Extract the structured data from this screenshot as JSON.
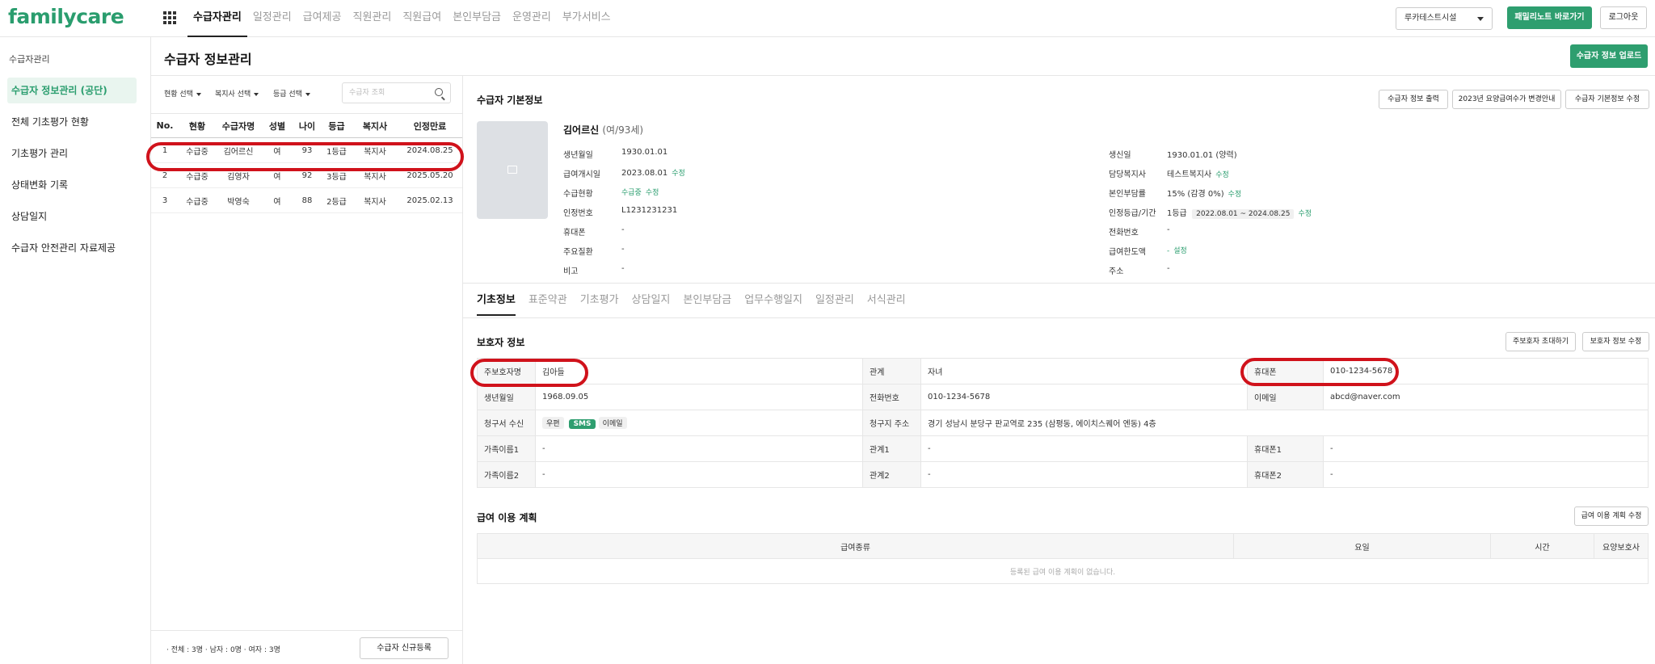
{
  "app": {
    "logo": "familycare"
  },
  "nav": {
    "items": [
      "수급자관리",
      "일정관리",
      "급여제공",
      "직원관리",
      "직원급여",
      "본인부담금",
      "운영관리",
      "부가서비스"
    ],
    "active_index": 0
  },
  "header": {
    "facility_select": "루카테스트시설",
    "family_button": "패밀리노트 바로가기",
    "logout_button": "로그아웃"
  },
  "sidebar": {
    "heading": "수급자관리",
    "items": [
      "수급자 정보관리 (공단)",
      "전체 기초평가 현황",
      "기초평가 관리",
      "상태변화 기록",
      "상담일지",
      "수급자 안전관리 자료제공"
    ],
    "active_index": 0
  },
  "page": {
    "title": "수급자 정보관리",
    "upload_button": "수급자 정보 업로드"
  },
  "list": {
    "filters": [
      "현황 선택",
      "복지사 선택",
      "등급 선택"
    ],
    "search_placeholder": "수급자 조회",
    "columns": [
      "No.",
      "현황",
      "수급자명",
      "성별",
      "나이",
      "등급",
      "복지사",
      "인정만료"
    ],
    "rows": [
      [
        "1",
        "수급중",
        "김어르신",
        "여",
        "93",
        "1등급",
        "복지사",
        "2024.08.25"
      ],
      [
        "2",
        "수급중",
        "김영자",
        "여",
        "92",
        "3등급",
        "복지사",
        "2025.05.20"
      ],
      [
        "3",
        "수급중",
        "박영숙",
        "여",
        "88",
        "2등급",
        "복지사",
        "2025.02.13"
      ]
    ],
    "counts": "· 전체 : 3명    · 남자 : 0명    · 여자 : 3명",
    "new_button": "수급자 신규등록"
  },
  "basic": {
    "title": "수급자 기본정보",
    "buttons": [
      "수급자 정보 출력",
      "2023년 요양급여수가 변경안내",
      "수급자 기본정보 수정"
    ],
    "name": "김어르신",
    "age": "(여/93세)",
    "left": {
      "labels": [
        "생년월일",
        "급여개시일",
        "수급현황",
        "인정번호",
        "휴대폰",
        "주요질환",
        "비고"
      ],
      "birth": "1930.01.01",
      "start": "2023.08.01",
      "status": "수급중",
      "cert_no": "L1231231231",
      "phone": "-",
      "disease": "-",
      "note": "-"
    },
    "right": {
      "labels": [
        "생신일",
        "담당복지사",
        "본인부담률",
        "인정등급/기간",
        "전화번호",
        "급여한도액",
        "주소"
      ],
      "birthday": "1930.01.01 (양력)",
      "worker": "테스트복지사",
      "rate": "15% (감경 0%)",
      "grade": "1등급",
      "period": "2022.08.01 ~ 2024.08.25",
      "tel": "-",
      "limit": "-",
      "limit_link": "설정",
      "address": "-"
    },
    "edit_label": "수정"
  },
  "tabs": [
    "기초정보",
    "표준약관",
    "기초평가",
    "상담일지",
    "본인부담금",
    "업무수행일지",
    "일정관리",
    "서식관리"
  ],
  "guardian": {
    "title": "보호자 정보",
    "buttons": [
      "주보호자 초대하기",
      "보호자 정보 수정"
    ],
    "rows": [
      [
        "주보호자명",
        "김아들",
        "관계",
        "자녀",
        "휴대폰",
        "010-1234-5678"
      ],
      [
        "생년월일",
        "1968.09.05",
        "전화번호",
        "010-1234-5678",
        "이메일",
        "abcd@naver.com"
      ],
      [
        "청구서 수신",
        "",
        "청구지 주소",
        "경기 성남시 분당구 판교역로 235 (삼평동, 에이치스퀘어 엔동) 4층",
        "",
        ""
      ],
      [
        "가족이름1",
        "-",
        "관계1",
        "-",
        "휴대폰1",
        "-"
      ],
      [
        "가족이름2",
        "-",
        "관계2",
        "-",
        "휴대폰2",
        "-"
      ]
    ],
    "receive_options": [
      "우편",
      "SMS",
      "이메일"
    ]
  },
  "plan": {
    "title": "급여 이용 계획",
    "edit_button": "급여 이용 계획 수정",
    "columns": [
      "급여종류",
      "요일",
      "시간",
      "요양보호사"
    ],
    "empty": "등록된 급여 이용 계획이 없습니다."
  }
}
